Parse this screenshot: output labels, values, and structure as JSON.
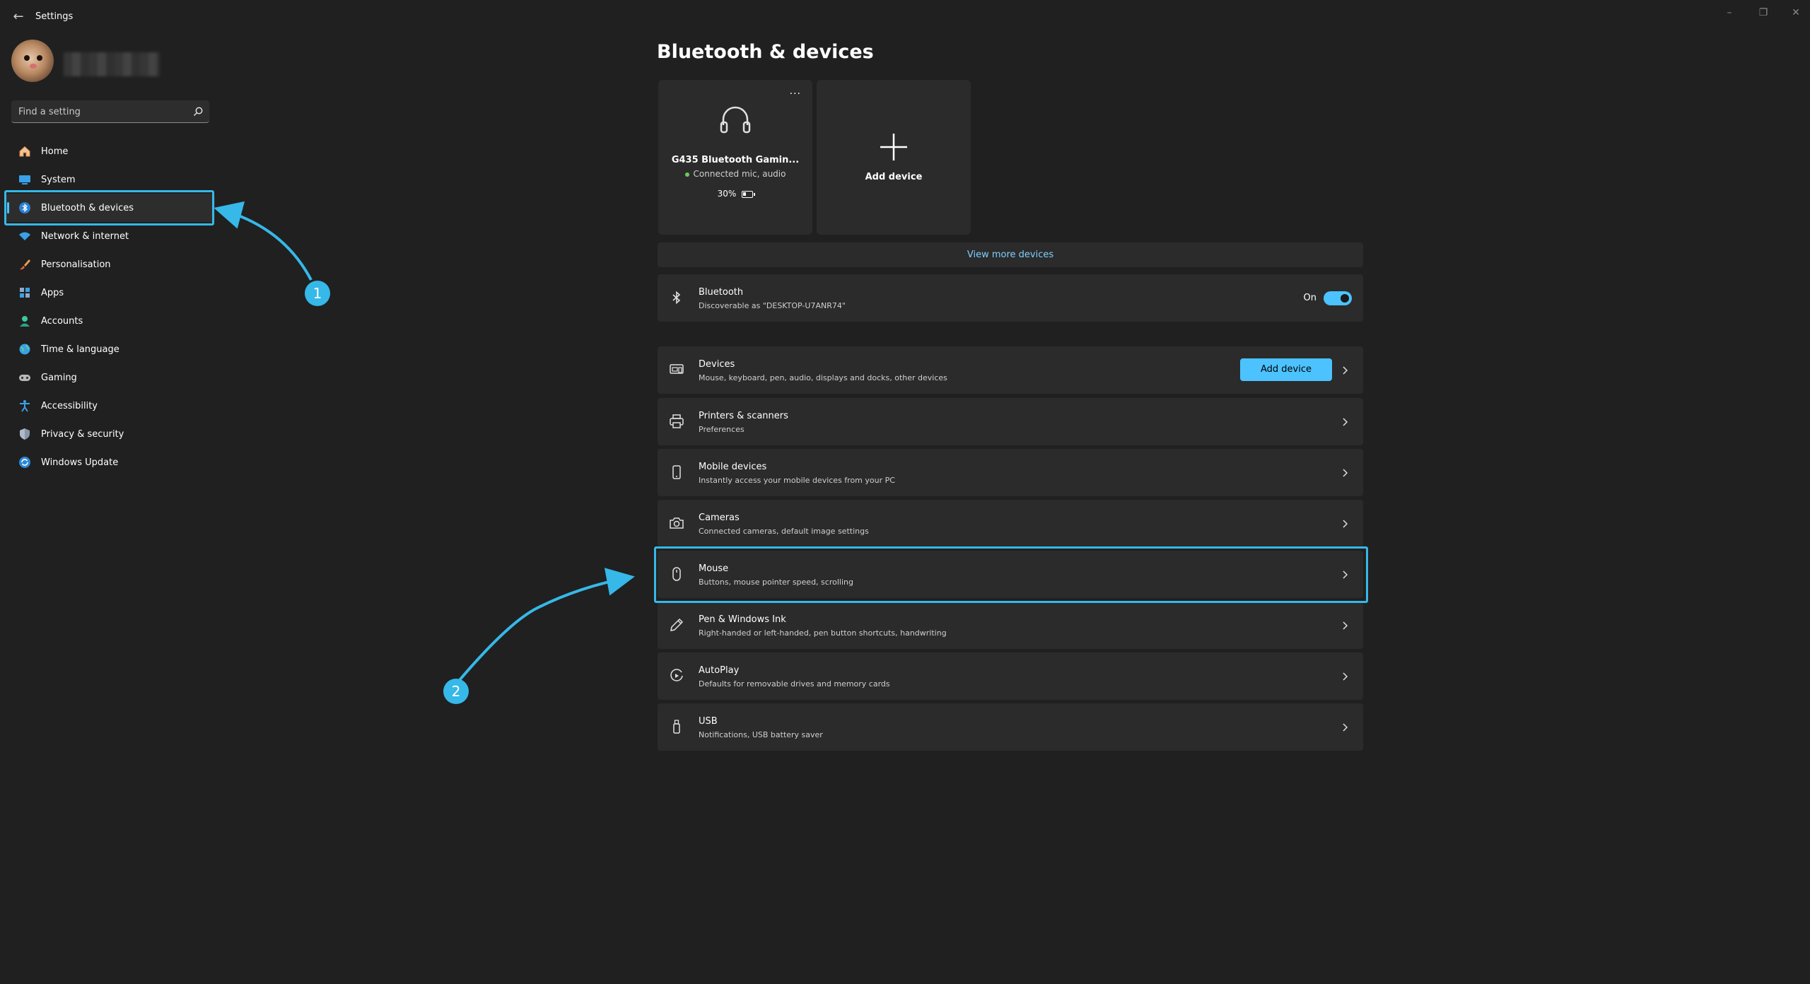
{
  "window": {
    "title": "Settings",
    "controls": [
      "minimize-icon",
      "restore-icon",
      "close-icon"
    ]
  },
  "search": {
    "placeholder": "Find a setting"
  },
  "nav": {
    "items": [
      {
        "label": "Home",
        "icon": "home-icon"
      },
      {
        "label": "System",
        "icon": "system-icon"
      },
      {
        "label": "Bluetooth & devices",
        "icon": "bluetooth-icon",
        "active": true
      },
      {
        "label": "Network & internet",
        "icon": "wifi-icon"
      },
      {
        "label": "Personalisation",
        "icon": "brush-icon"
      },
      {
        "label": "Apps",
        "icon": "apps-icon"
      },
      {
        "label": "Accounts",
        "icon": "accounts-icon"
      },
      {
        "label": "Time & language",
        "icon": "globe-icon"
      },
      {
        "label": "Gaming",
        "icon": "gamepad-icon"
      },
      {
        "label": "Accessibility",
        "icon": "accessibility-icon"
      },
      {
        "label": "Privacy & security",
        "icon": "shield-icon"
      },
      {
        "label": "Windows Update",
        "icon": "update-icon"
      }
    ]
  },
  "main": {
    "title": "Bluetooth & devices",
    "device_card": {
      "name": "G435 Bluetooth Gamin...",
      "status": "Connected mic, audio",
      "battery": "30%",
      "more": "..."
    },
    "add_card": {
      "label": "Add device"
    },
    "view_more": "View more devices",
    "bluetooth": {
      "title": "Bluetooth",
      "subtitle": "Discoverable as \"DESKTOP-U7ANR74\"",
      "state": "On"
    },
    "rows": [
      {
        "title": "Devices",
        "subtitle": "Mouse, keyboard, pen, audio, displays and docks, other devices",
        "button": "Add device",
        "icon": "devices-icon"
      },
      {
        "title": "Printers & scanners",
        "subtitle": "Preferences",
        "icon": "printer-icon"
      },
      {
        "title": "Mobile devices",
        "subtitle": "Instantly access your mobile devices from your PC",
        "icon": "phone-icon"
      },
      {
        "title": "Cameras",
        "subtitle": "Connected cameras, default image settings",
        "icon": "camera-icon"
      },
      {
        "title": "Mouse",
        "subtitle": "Buttons, mouse pointer speed, scrolling",
        "icon": "mouse-icon"
      },
      {
        "title": "Pen & Windows Ink",
        "subtitle": "Right-handed or left-handed, pen button shortcuts, handwriting",
        "icon": "pen-icon"
      },
      {
        "title": "AutoPlay",
        "subtitle": "Defaults for removable drives and memory cards",
        "icon": "autoplay-icon"
      },
      {
        "title": "USB",
        "subtitle": "Notifications, USB battery saver",
        "icon": "usb-icon"
      }
    ]
  },
  "annotations": {
    "badges": [
      "1",
      "2"
    ],
    "color": "#36b8e8"
  },
  "colors": {
    "background": "#202020",
    "card": "#2b2b2b",
    "accent": "#4cc2ff",
    "link": "#7fd0ff"
  }
}
